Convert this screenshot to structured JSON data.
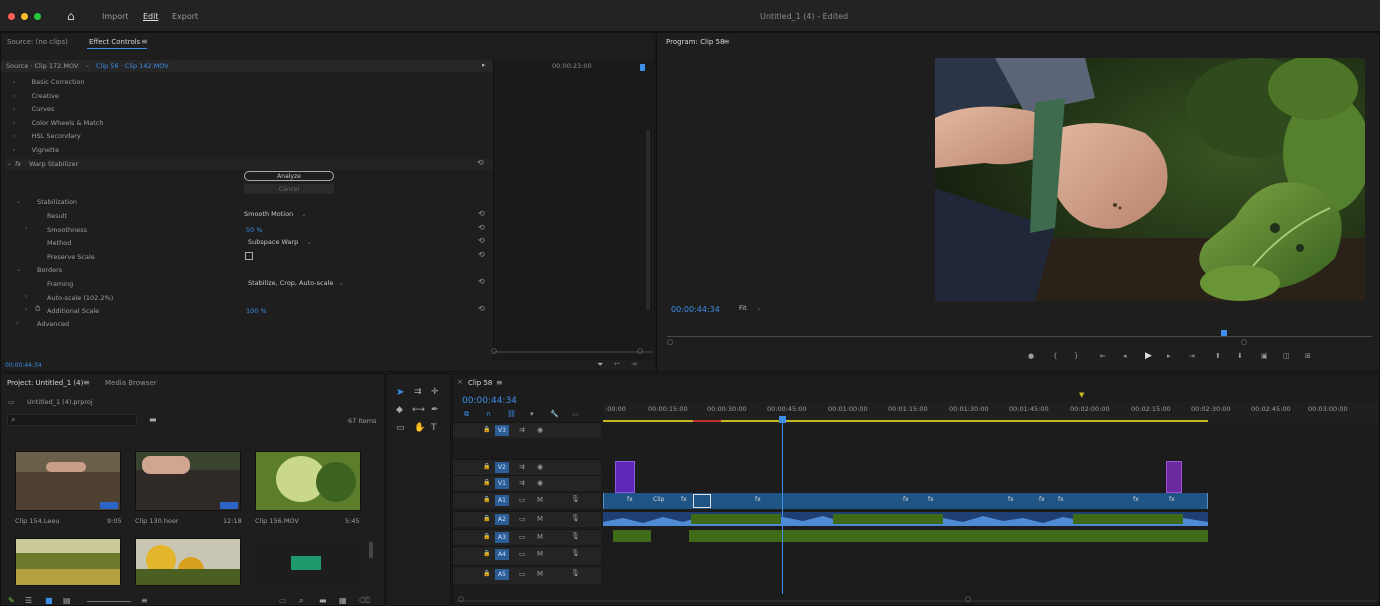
{
  "topbar": {
    "nav": [
      "Import",
      "Edit",
      "Export"
    ],
    "title": "Untitled_1 (4) - Edited"
  },
  "source_panel": {
    "tabs": [
      "Source: (no clips)",
      "Effect Controls"
    ],
    "source_line": "Source · Clip 172.MOV",
    "clip_line": "Clip 56 · Clip 142.MOV",
    "timecode": "00:00:23:00",
    "sections": [
      "Basic Correction",
      "Creative",
      "Curves",
      "Color Wheels & Match",
      "HSL Secondary",
      "Vignette"
    ],
    "effect_name": "Warp Stabilizer",
    "analyze_label": "Analyze",
    "cancel_label": "Cancel",
    "stabilization_label": "Stabilization",
    "result_label": "Result",
    "result_value": "Smooth Motion",
    "smoothness_label": "Smoothness",
    "smoothness_value": "50 %",
    "method_label": "Method",
    "method_value": "Subspace Warp",
    "preserve_label": "Preserve Scale",
    "borders_label": "Borders",
    "framing_label": "Framing",
    "framing_value": "Stabilize, Crop, Auto-scale",
    "autoscale_label": "Auto-scale (102.2%)",
    "additional_label": "Additional Scale",
    "additional_value": "100 %",
    "advanced_label": "Advanced",
    "bottom_timecode": "00:00:44:34"
  },
  "program": {
    "title": "Program: Clip 58",
    "timecode": "00:00:44:34",
    "fit_label": "Fit"
  },
  "project": {
    "tabs": [
      "Project: Untitled_1 (4)",
      "Media Browser"
    ],
    "path": "Untitled_1 (4).prproj",
    "items_count": "67 Items",
    "clips": [
      {
        "name": "Clip 154.Leeu",
        "duration": "9:05"
      },
      {
        "name": "Clip 130.hoer",
        "duration": "12:18"
      },
      {
        "name": "Clip 156.MOV",
        "duration": "5:45"
      }
    ]
  },
  "timeline": {
    "tab": "Clip 58",
    "timecode": "00:00:44:34",
    "ruler": [
      ":00:00",
      "00:00:15:00",
      "00:00:30:00",
      "00:00:45:00",
      "00:01:00:00",
      "00:01:15:00",
      "00:01:30:00",
      "00:01:45:00",
      "00:02:00:00",
      "00:02:15:00",
      "00:02:30:00",
      "00:02:45:00",
      "00:03:00:00"
    ],
    "tracks": [
      "V3",
      "V2",
      "V1",
      "A1",
      "A2",
      "A3",
      "A4",
      "A5"
    ],
    "clip_label": "Clip"
  },
  "colors": {
    "accent": "#3c8ee8",
    "clip_video": "#1e5585",
    "clip_audio": "#1d3f73",
    "audio_green": "#3f6a18",
    "purple": "#5d27b8"
  }
}
